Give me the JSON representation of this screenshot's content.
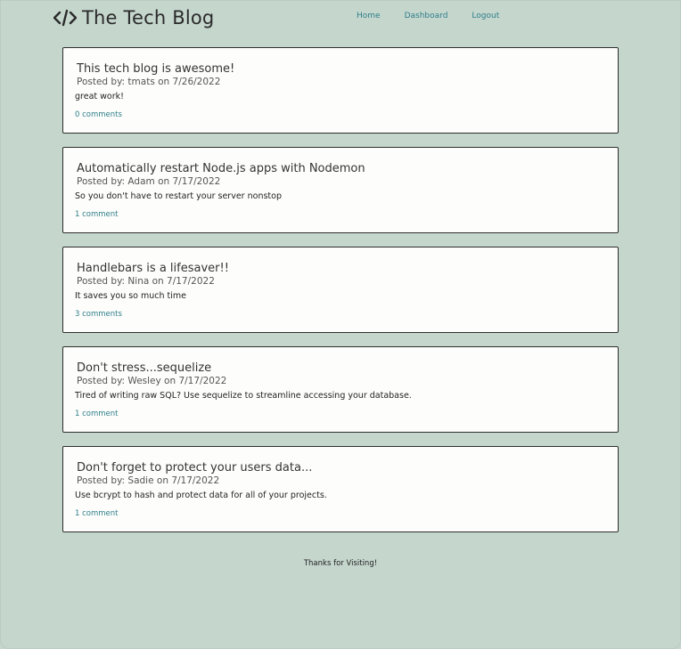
{
  "header": {
    "brand_title": "The Tech Blog",
    "brand_icon": "code-icon"
  },
  "nav": {
    "items": [
      {
        "label": "Home"
      },
      {
        "label": "Dashboard"
      },
      {
        "label": "Logout"
      }
    ]
  },
  "posts": [
    {
      "title": "This tech blog is awesome!",
      "meta": "Posted by: tmats on 7/26/2022",
      "body": "great work!",
      "comments": "0 comments"
    },
    {
      "title": "Automatically restart Node.js apps with Nodemon",
      "meta": "Posted by: Adam on 7/17/2022",
      "body": "So you don't have to restart your server nonstop",
      "comments": "1 comment"
    },
    {
      "title": "Handlebars is a lifesaver!!",
      "meta": "Posted by: Nina on 7/17/2022",
      "body": "It saves you so much time",
      "comments": "3 comments"
    },
    {
      "title": "Don't stress...sequelize",
      "meta": "Posted by: Wesley on 7/17/2022",
      "body": "Tired of writing raw SQL? Use sequelize to streamline accessing your database.",
      "comments": "1 comment"
    },
    {
      "title": "Don't forget to protect your users data...",
      "meta": "Posted by: Sadie on 7/17/2022",
      "body": "Use bcrypt to hash and protect data for all of your projects.",
      "comments": "1 comment"
    }
  ],
  "footer": {
    "text": "Thanks for Visiting!"
  },
  "colors": {
    "background": "#c5d6cd",
    "card": "#fdfdfb",
    "link": "#2e7f8a"
  }
}
